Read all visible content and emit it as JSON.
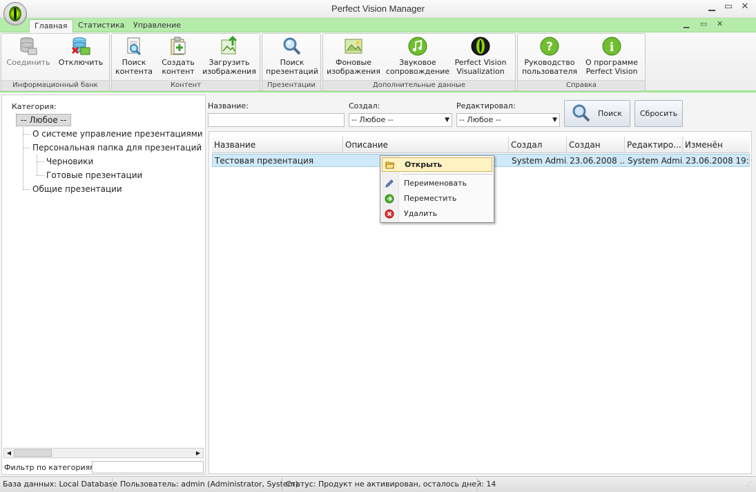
{
  "window": {
    "title": "Perfect Vision Manager"
  },
  "tabs": [
    {
      "label": "Главная",
      "active": true
    },
    {
      "label": "Статистика",
      "active": false
    },
    {
      "label": "Управление",
      "active": false
    }
  ],
  "ribbon": {
    "groups": [
      {
        "label": "Информационный банк",
        "buttons": [
          {
            "line1": "Соединить",
            "line2": "",
            "icon": "database-connect-icon",
            "disabled": true
          },
          {
            "line1": "Отключить",
            "line2": "",
            "icon": "database-disconnect-icon",
            "disabled": false
          }
        ]
      },
      {
        "label": "Контент",
        "buttons": [
          {
            "line1": "Поиск",
            "line2": "контента",
            "icon": "search-content-icon"
          },
          {
            "line1": "Создать",
            "line2": "контент",
            "icon": "create-content-icon"
          },
          {
            "line1": "Загрузить",
            "line2": "изображения",
            "icon": "upload-images-icon"
          }
        ]
      },
      {
        "label": "Презентации",
        "buttons": [
          {
            "line1": "Поиск",
            "line2": "презентаций",
            "icon": "search-presentations-icon"
          }
        ]
      },
      {
        "label": "Дополнительные данные",
        "buttons": [
          {
            "line1": "Фоновые",
            "line2": "изображения",
            "icon": "background-images-icon"
          },
          {
            "line1": "Звуковое",
            "line2": "сопровождение",
            "icon": "music-note-icon"
          },
          {
            "line1": "Perfect Vision",
            "line2": "Visualization",
            "icon": "pv-eye-icon"
          }
        ]
      },
      {
        "label": "Справка",
        "buttons": [
          {
            "line1": "Руководство",
            "line2": "пользователя",
            "icon": "help-question-icon"
          },
          {
            "line1": "О программе",
            "line2": "Perfect Vision",
            "icon": "info-icon"
          }
        ]
      }
    ]
  },
  "leftpanel": {
    "category_label": "Категория:",
    "tree": [
      {
        "label": "-- Любое --",
        "selected": true
      },
      {
        "label": "О системе управление презентациями"
      },
      {
        "label": "Персональная папка для презентаций"
      },
      {
        "label": "Черновики"
      },
      {
        "label": "Готовые презентации"
      },
      {
        "label": "Общие презентации"
      }
    ],
    "filter_label": "Фильтр по категориям:",
    "filter_value": ""
  },
  "search": {
    "name_label": "Название:",
    "name_value": "",
    "created_by_label": "Создал:",
    "created_by_value": "-- Любое --",
    "edited_by_label": "Редактировал:",
    "edited_by_value": "-- Любое --",
    "search_button": "Поиск",
    "reset_button": "Сбросить"
  },
  "grid": {
    "columns": [
      "Название",
      "Описание",
      "Создал",
      "Создан",
      "Редактиро...",
      "Изменён"
    ],
    "rows": [
      [
        "Тестовая презентация",
        "",
        "System Admi...",
        "23.06.2008 ...",
        "System Admi...",
        "23.06.2008 19:..."
      ]
    ]
  },
  "context_menu": {
    "items": [
      {
        "label": "Открыть",
        "icon": "open-folder-icon",
        "highlighted": true
      },
      {
        "label": "Переименовать",
        "icon": "pencil-icon"
      },
      {
        "label": "Переместить",
        "icon": "move-arrow-icon"
      },
      {
        "label": "Удалить",
        "icon": "delete-icon"
      }
    ]
  },
  "statusbar": {
    "database": "База данных: Local Database",
    "user": "Пользователь: admin (Administrator, System).",
    "status": "Статус: Продукт не активирован, осталось дней: 14"
  }
}
